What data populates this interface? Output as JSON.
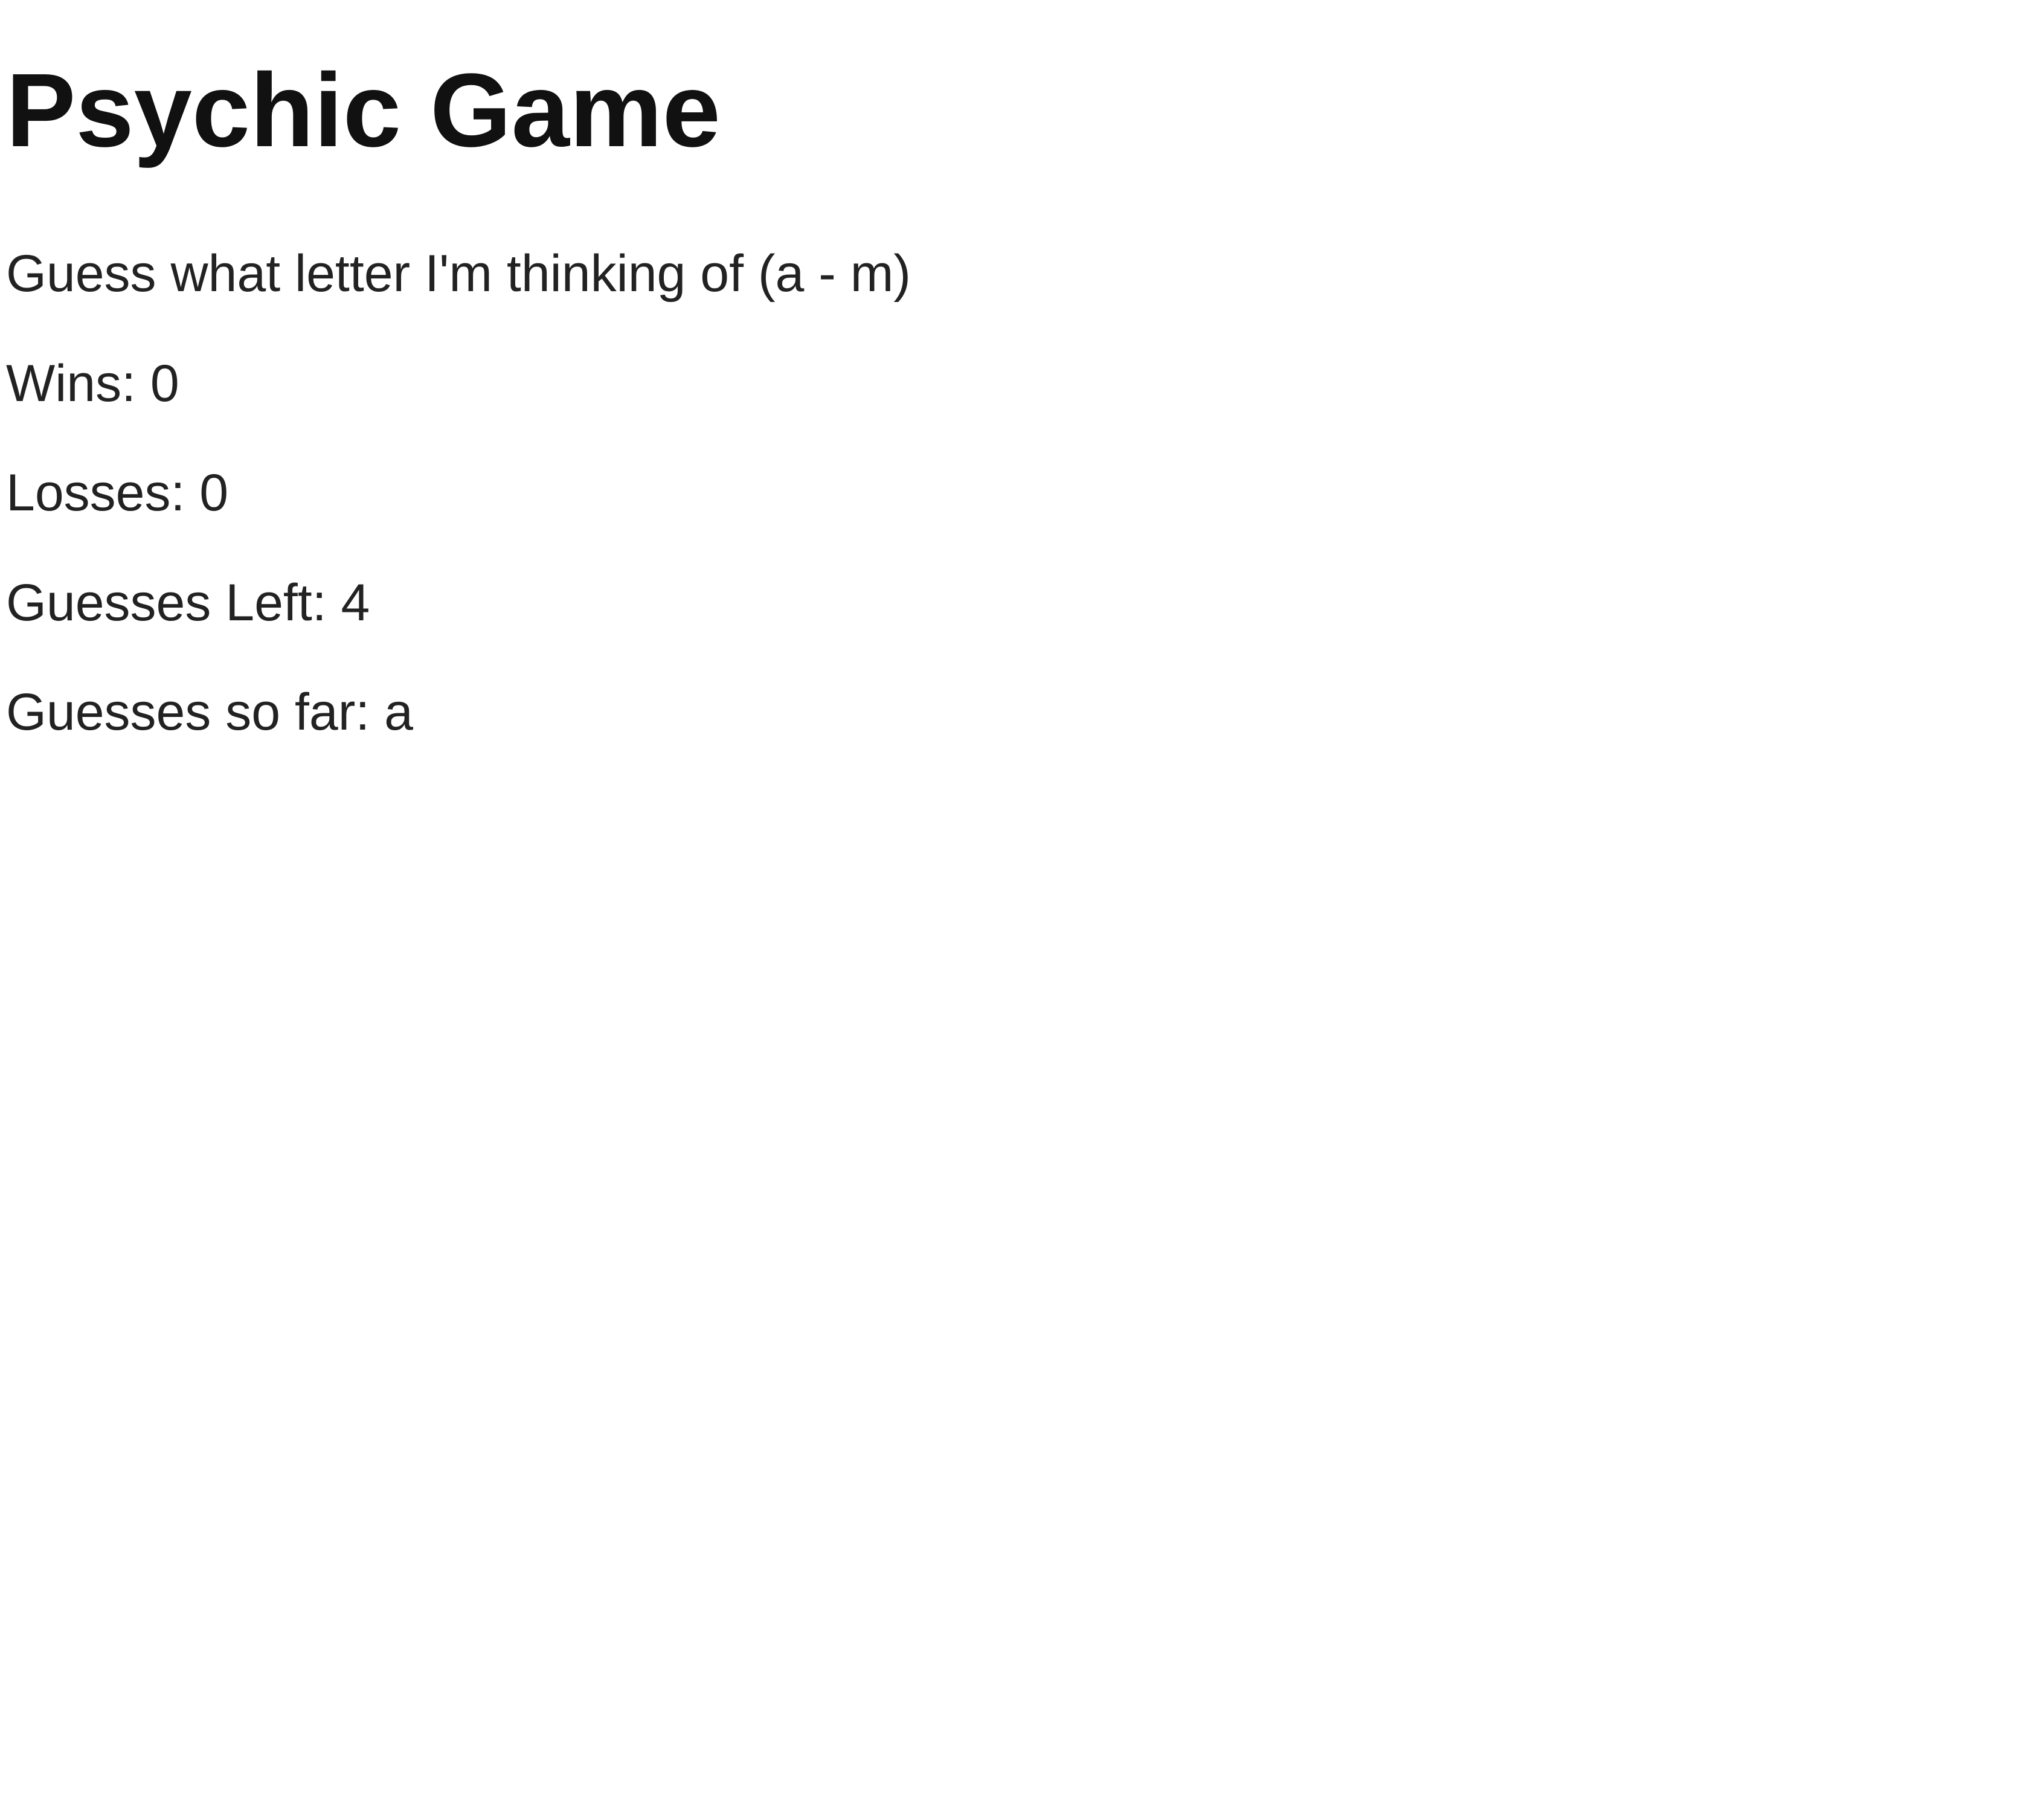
{
  "game": {
    "title": "Psychic Game",
    "instructions": "Guess what letter I'm thinking of (a - m)",
    "stats": {
      "wins": "Wins: 0",
      "losses": "Losses: 0",
      "guesses_left": "Guesses Left: 4",
      "guesses_so_far": "Guesses so far: a"
    }
  }
}
